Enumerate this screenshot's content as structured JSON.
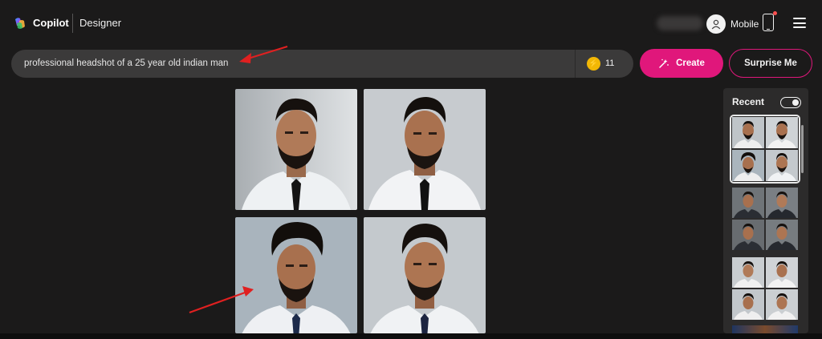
{
  "header": {
    "brand": "Copilot",
    "product": "Designer",
    "user_label": "Mobile",
    "icons": [
      "copilot-logo-icon",
      "user-avatar-icon",
      "mobile-phone-icon",
      "hamburger-menu-icon"
    ]
  },
  "prompt": {
    "value": "professional headshot of a 25 year old indian man",
    "boost_count": "11"
  },
  "buttons": {
    "create": "Create",
    "surprise": "Surprise Me"
  },
  "recent": {
    "title": "Recent",
    "toggle_on": true
  },
  "colors": {
    "accent": "#e0177b",
    "background": "#1b1a1a",
    "prompt_bg": "#3b3a3a",
    "boost": "#f2b705",
    "annotation_arrow": "#e02020"
  }
}
